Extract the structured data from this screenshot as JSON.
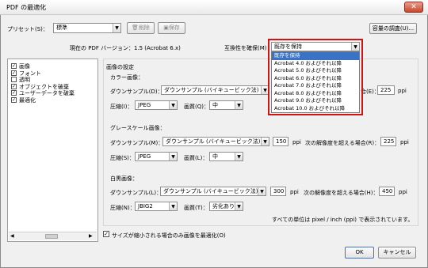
{
  "window": {
    "title": "PDF の最適化",
    "close_label": "✕"
  },
  "toolbar": {
    "preset_label": "プリセット(S)：",
    "preset_value": "標準",
    "delete_label": "削除",
    "save_label": "保存",
    "audit_label": "容量の調査(U)..."
  },
  "version": {
    "current_label": "現在の PDF バージョン：1.5 (Acrobat 6.x)",
    "compat_label": "互換性を確保(M)：",
    "compat_value": "既存を保持",
    "options": [
      "既存を保持",
      "Acrobat 4.0 およびそれ以降",
      "Acrobat 5.0 およびそれ以降",
      "Acrobat 6.0 およびそれ以降",
      "Acrobat 7.0 およびそれ以降",
      "Acrobat 8.0 およびそれ以降",
      "Acrobat 9.0 およびそれ以降",
      "Acrobat 10.0 およびそれ以降"
    ]
  },
  "sidebar": {
    "items": [
      {
        "label": "画像",
        "checked": true
      },
      {
        "label": "フォント",
        "checked": true
      },
      {
        "label": "透明",
        "checked": false
      },
      {
        "label": "オブジェクトを破棄",
        "checked": true
      },
      {
        "label": "ユーザーデータを破棄",
        "checked": true
      },
      {
        "label": "最適化",
        "checked": true
      }
    ]
  },
  "image_settings": {
    "header": "画像の設定",
    "color": {
      "title": "カラー画像：",
      "downsample_label": "ダウンサンプル(D)：",
      "downsample_value": "ダウンサンプル (バイキュービック法)",
      "ppi_value_right": "225",
      "ppi_label": "ppi",
      "compress_label": "圧縮(I)：",
      "compress_value": "JPEG",
      "quality_label": "画質(Q)：",
      "quality_value": "中",
      "threshold_suffix": "合(E)："
    },
    "gray": {
      "title": "グレースケール画像：",
      "downsample_label": "ダウンサンプル(M)：",
      "downsample_value": "ダウンサンプル (バイキュービック法)",
      "ppi_value": "150",
      "ppi_label": "ppi",
      "threshold_label": "次の解像度を超える場合(R)：",
      "threshold_value": "225",
      "threshold_ppi": "ppi",
      "compress_label": "圧縮(S)：",
      "compress_value": "JPEG",
      "quality_label": "画質(L)：",
      "quality_value": "中"
    },
    "mono": {
      "title": "白黒画像：",
      "downsample_label": "ダウンサンプル(L)：",
      "downsample_value": "ダウンサンプル (バイキュービック法)",
      "ppi_value": "300",
      "ppi_label": "ppi",
      "threshold_label": "次の解像度を超える場合(H)：",
      "threshold_value": "450",
      "threshold_ppi": "ppi",
      "compress_label": "圧縮(N)：",
      "compress_value": "JBIG2",
      "quality_label": "画質(T)：",
      "quality_value": "劣化あり"
    },
    "unit_note": "すべての単位は pixel / inch (ppi) で表示されています。"
  },
  "footer": {
    "optimize_label": "サイズが縮小される場合のみ画像を最適化(O)",
    "ok_label": "OK",
    "cancel_label": "キャンセル"
  }
}
